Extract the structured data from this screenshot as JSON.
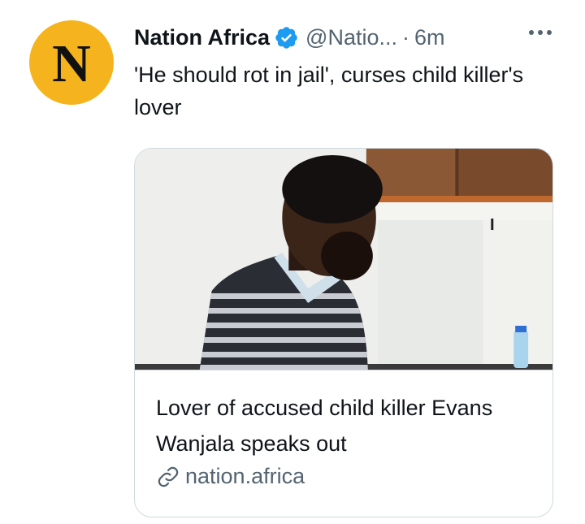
{
  "avatar": {
    "letter": "N",
    "color": "#f5b41d"
  },
  "author": {
    "name": "Nation Africa",
    "handle": "@Natio...",
    "separator": "·",
    "time": "6m"
  },
  "icons": {
    "verified": "verified-badge-icon",
    "more": "more-options-icon",
    "link": "link-icon"
  },
  "tweet": {
    "text": "'He should rot in jail', curses child killer's lover"
  },
  "card": {
    "title": "Lover of accused child killer Evans Wanjala speaks out",
    "domain": "nation.africa"
  },
  "colors": {
    "verified": "#1d9bf0",
    "secondary_text": "#536471",
    "border": "#cfd9de"
  }
}
